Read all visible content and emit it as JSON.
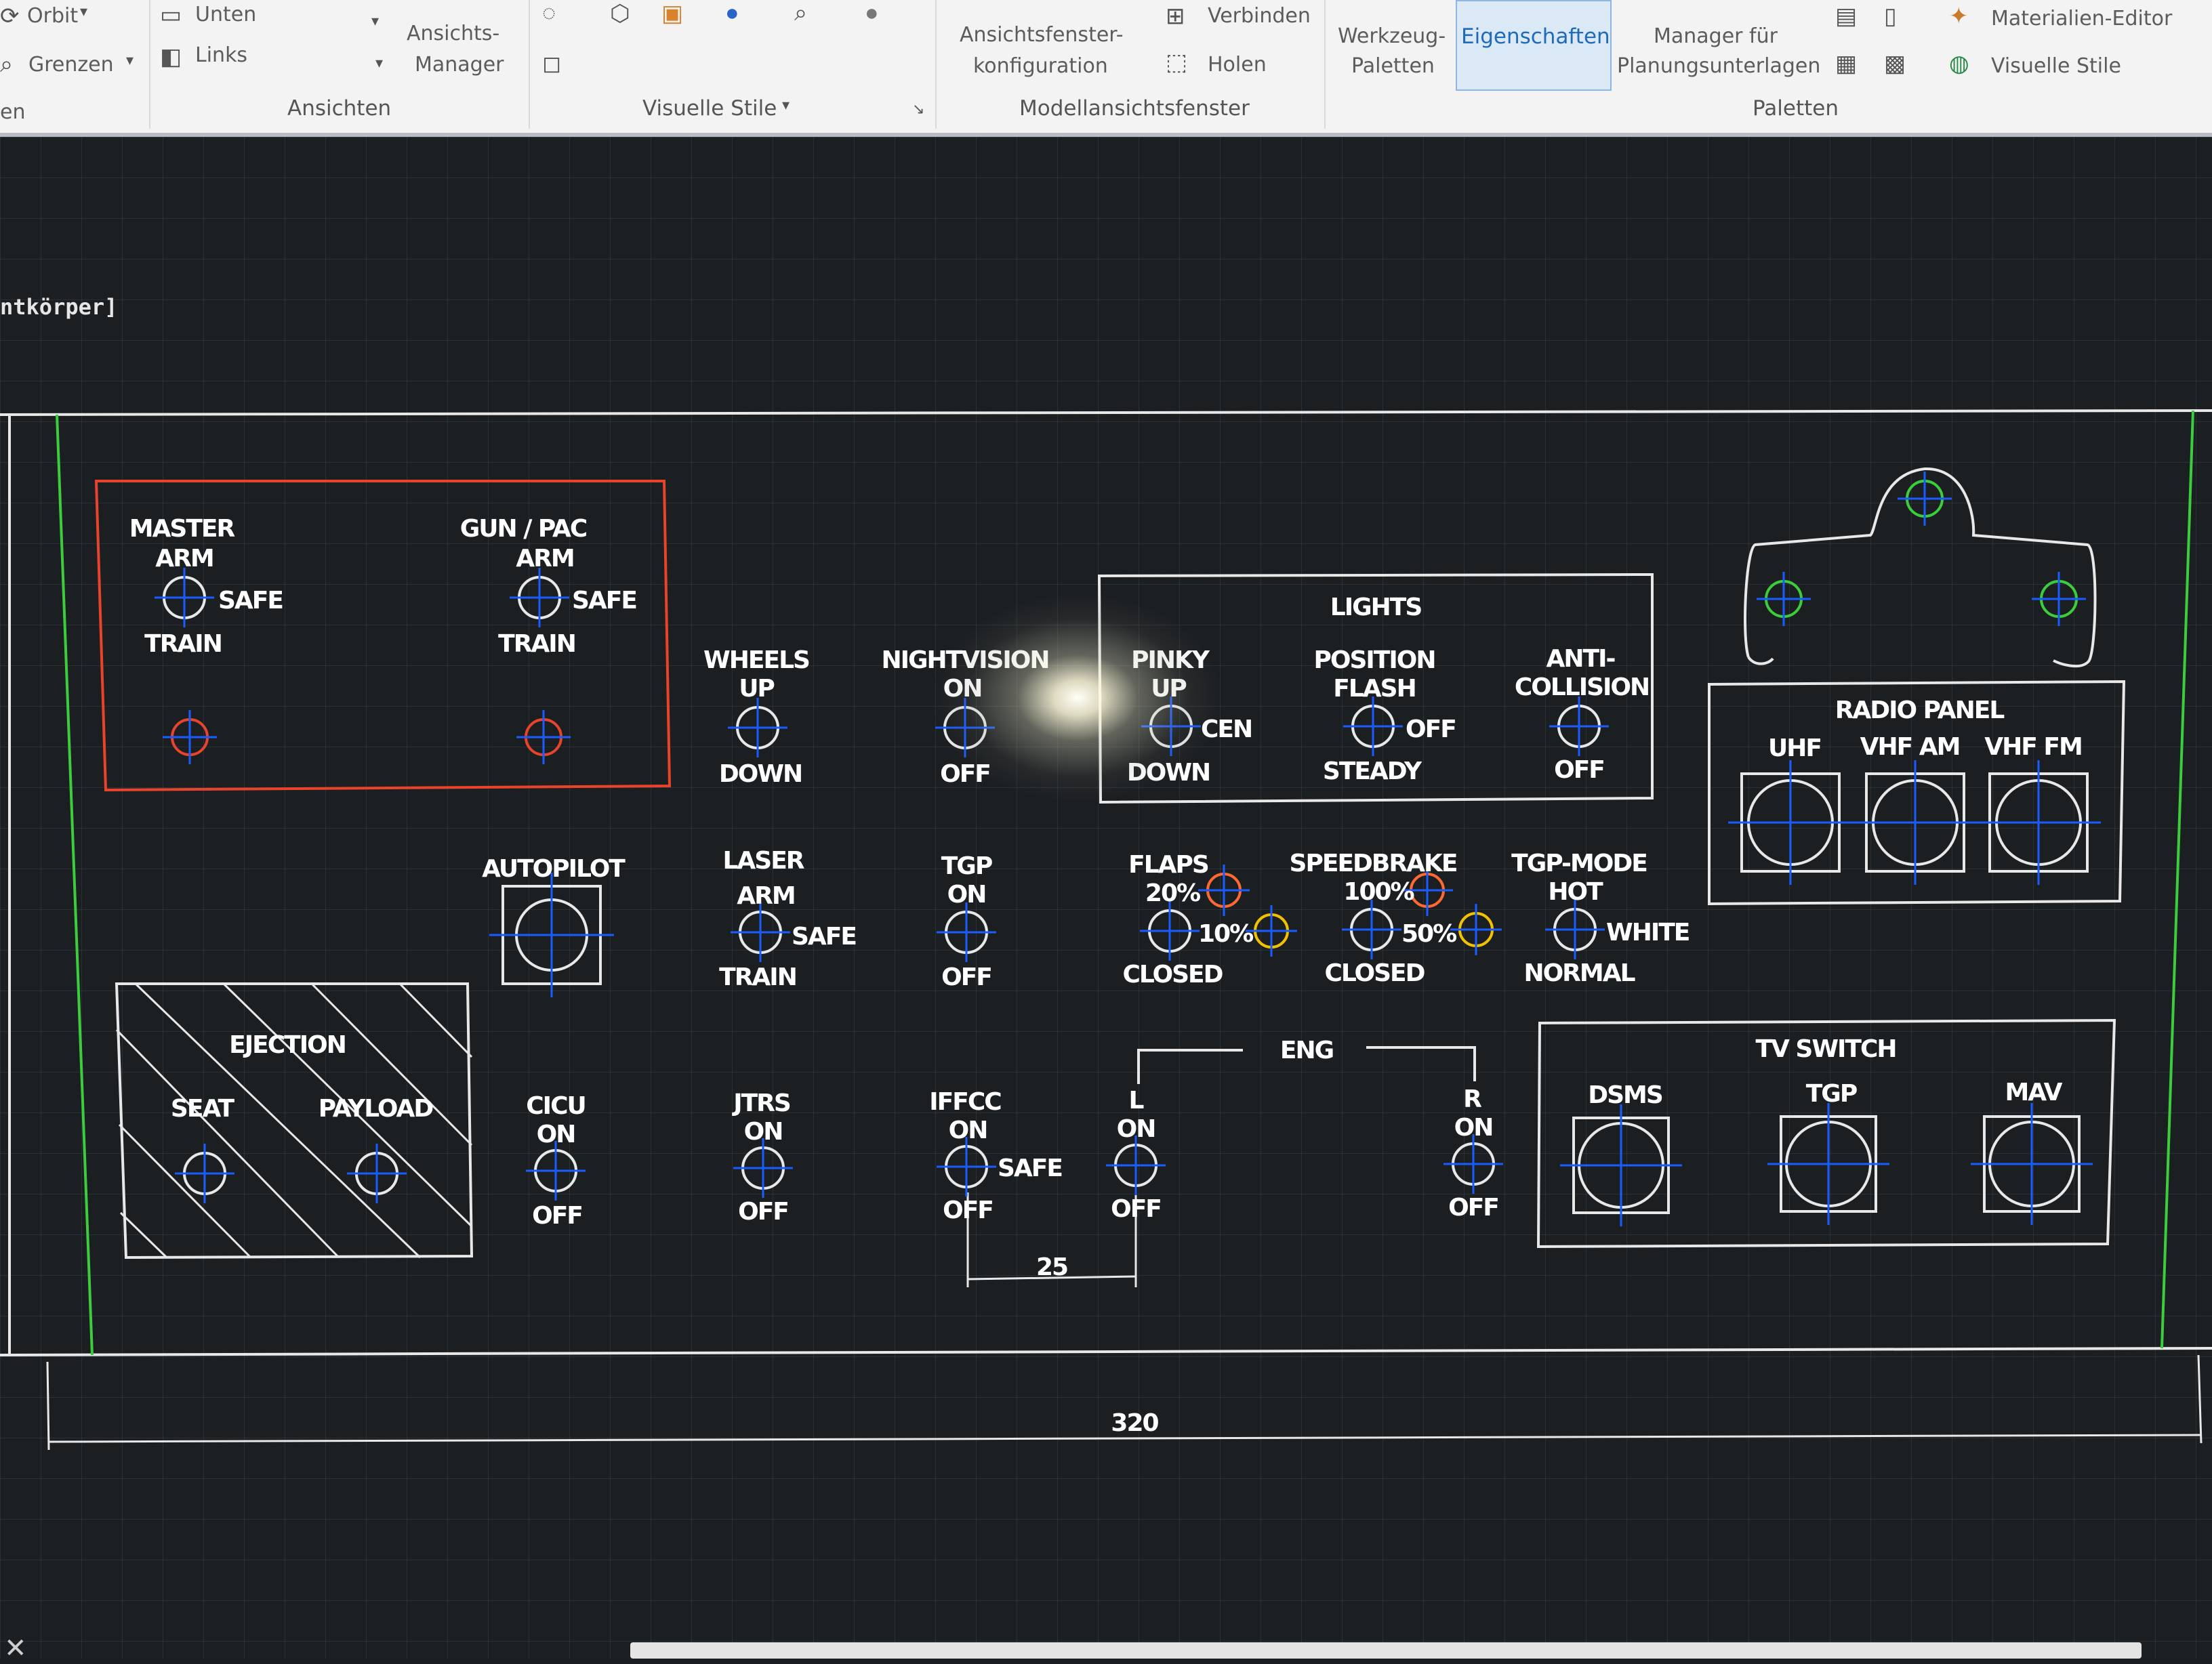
{
  "ribbon": {
    "orbit": "Orbit",
    "grenzen": "Grenzen",
    "en": "en",
    "unten": "Unten",
    "links": "Links",
    "ansichts_manager_1": "Ansichts-",
    "ansichts_manager_2": "Manager",
    "ansichten": "Ansichten",
    "visuelle_stile_group": "Visuelle Stile",
    "ansichtsfenster_1": "Ansichtsfenster-",
    "ansichtsfenster_2": "konfiguration",
    "verbinden": "Verbinden",
    "holen": "Holen",
    "modellansichtsfenster": "Modellansichtsfenster",
    "werkzeug_1": "Werkzeug-",
    "werkzeug_2": "Paletten",
    "eigenschaften": "Eigenschaften",
    "manager_1": "Manager für",
    "manager_2": "Planungsunterlagen",
    "materialien_editor": "Materialien-Editor",
    "visuelle_stile": "Visuelle Stile",
    "paletten": "Paletten"
  },
  "viewport": {
    "label": "ntkörper]"
  },
  "colors": {
    "cad_white": "#ffffff",
    "cad_red": "#e8432c",
    "cad_green": "#3ccd3c",
    "cad_blue": "#1a5cff",
    "cad_cyan": "#7fd8ff",
    "cad_orange": "#ff6a33",
    "cad_yellow": "#f2c200",
    "ribbon_accent": "#1e6bb8"
  },
  "panel": {
    "master_arm": {
      "title": "MASTER",
      "arm": "ARM",
      "safe": "SAFE",
      "train": "TRAIN"
    },
    "gun_pac": {
      "title": "GUN / PAC",
      "arm": "ARM",
      "safe": "SAFE",
      "train": "TRAIN"
    },
    "wheels": {
      "title": "WHEELS",
      "up": "UP",
      "down": "DOWN"
    },
    "nightvision": {
      "title": "NIGHTVISION",
      "on": "ON",
      "off": "OFF"
    },
    "lights": {
      "title": "LIGHTS",
      "pinky": {
        "title": "PINKY",
        "up": "UP",
        "cen": "CEN",
        "down": "DOWN"
      },
      "position": {
        "title": "POSITION",
        "flash": "FLASH",
        "off": "OFF",
        "steady": "STEADY"
      },
      "anti": {
        "title1": "ANTI-",
        "title2": "COLLISION",
        "off": "OFF"
      }
    },
    "radio": {
      "title": "RADIO PANEL",
      "uhf": "UHF",
      "vhf_am": "VHF AM",
      "vhf_fm": "VHF FM"
    },
    "autopilot": {
      "title": "AUTOPILOT"
    },
    "laser": {
      "title": "LASER",
      "arm": "ARM",
      "safe": "SAFE",
      "train": "TRAIN"
    },
    "tgp": {
      "title": "TGP",
      "on": "ON",
      "off": "OFF"
    },
    "flaps": {
      "title": "FLAPS",
      "p20": "20%",
      "p10": "10%",
      "closed": "CLOSED"
    },
    "speedbrake": {
      "title": "SPEEDBRAKE",
      "p100": "100%",
      "p50": "50%",
      "closed": "CLOSED"
    },
    "tgp_mode": {
      "title": "TGP-MODE",
      "hot": "HOT",
      "white": "WHITE",
      "normal": "NORMAL"
    },
    "ejection": {
      "title": "EJECTION",
      "seat": "SEAT",
      "payload": "PAYLOAD"
    },
    "cicu": {
      "title": "CICU",
      "on": "ON",
      "off": "OFF"
    },
    "jtrs": {
      "title": "JTRS",
      "on": "ON",
      "off": "OFF"
    },
    "iffcc": {
      "title": "IFFCC",
      "on": "ON",
      "safe": "SAFE",
      "off": "OFF"
    },
    "eng": {
      "title": "ENG",
      "l": "L",
      "r": "R",
      "on": "ON",
      "off": "OFF"
    },
    "tv_switch": {
      "title": "TV SWITCH",
      "dsms": "DSMS",
      "tgp": "TGP",
      "mav": "MAV"
    },
    "dim_25": "25",
    "dim_320": "320"
  }
}
